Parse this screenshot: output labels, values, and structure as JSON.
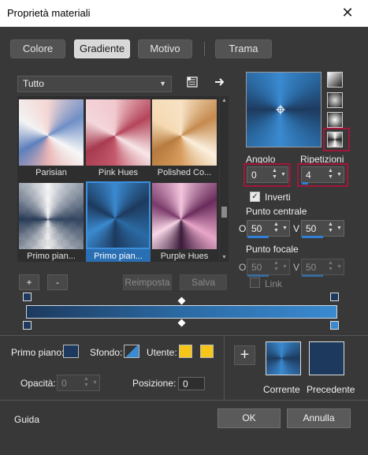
{
  "window": {
    "title": "Proprietà materiali",
    "close_glyph": "✕"
  },
  "tabs": [
    {
      "label": "Colore",
      "active": false
    },
    {
      "label": "Gradiente",
      "active": true
    },
    {
      "label": "Motivo",
      "active": false
    },
    {
      "label": "Trama",
      "active": false
    }
  ],
  "library": {
    "category": "Tutto",
    "thumbnails": [
      {
        "label": "Parisian"
      },
      {
        "label": "Pink Hues"
      },
      {
        "label": "Polished Co..."
      },
      {
        "label": "Primo pian..."
      },
      {
        "label": "Primo pian...",
        "selected": true
      },
      {
        "label": "Purple Hues"
      }
    ],
    "add_label": "+",
    "remove_label": "-",
    "reset_label": "Reimposta",
    "save_label": "Salva"
  },
  "gradient": {
    "angolo_label": "Angolo",
    "angolo_value": "0",
    "ripetizioni_label": "Ripetizioni",
    "ripetizioni_value": "4",
    "inverti_label": "Inverti",
    "inverti_checked": true,
    "punto_centrale_label": "Punto centrale",
    "centro_o_label": "O",
    "centro_o_value": "50",
    "centro_v_label": "V",
    "centro_v_value": "50",
    "punto_focale_label": "Punto focale",
    "focale_o_label": "O",
    "focale_o_value": "50",
    "focale_v_label": "V",
    "focale_v_value": "50",
    "link_label": "Link",
    "colors": {
      "dark": "#1d3a5e",
      "mid": "#2b6aa4",
      "light": "#3a8ad0",
      "highlight": "#a3163a"
    }
  },
  "stop_editor": {
    "primo_piano_label": "Primo piano:",
    "sfondo_label": "Sfondo:",
    "utente_label": "Utente:",
    "utente_color": "#f5c518",
    "opacita_label": "Opacità:",
    "opacita_value": "0",
    "posizione_label": "Posizione:",
    "posizione_value": "0"
  },
  "swatches": {
    "corrente_label": "Corrente",
    "precedente_label": "Precedente",
    "add_label": "+"
  },
  "footer": {
    "guida_label": "Guida",
    "ok_label": "OK",
    "annulla_label": "Annulla"
  }
}
